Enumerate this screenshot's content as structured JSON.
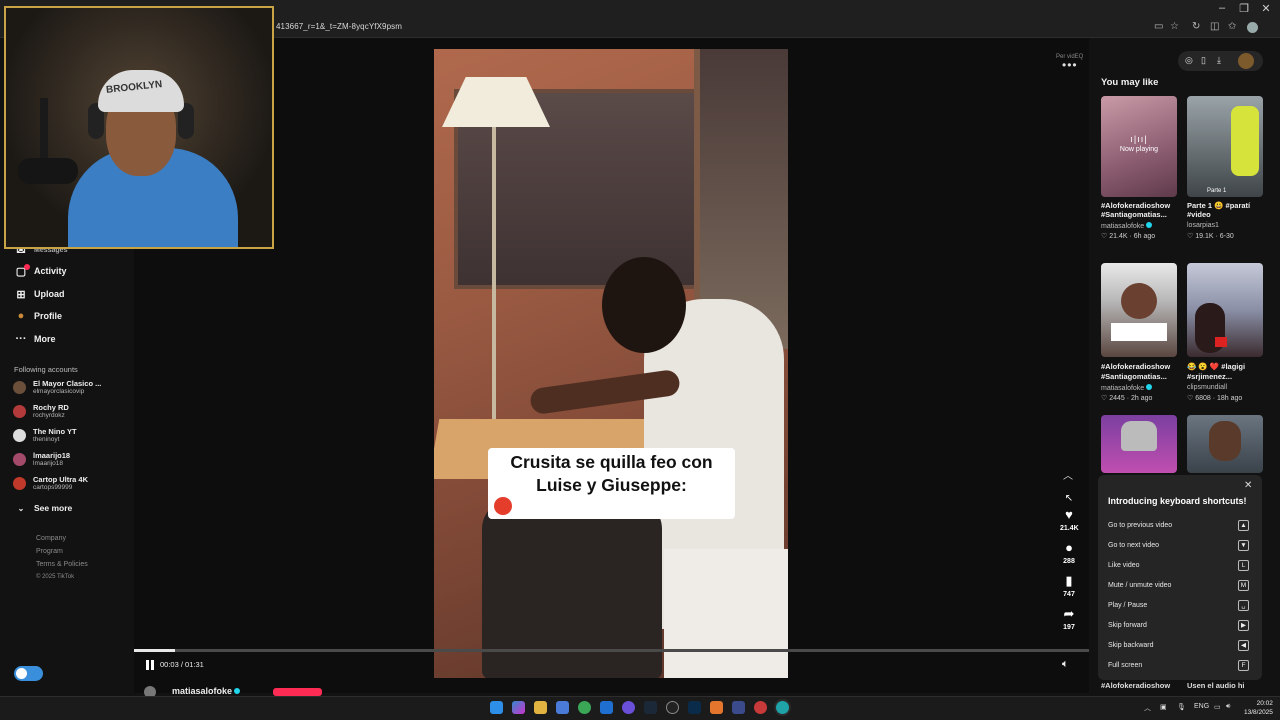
{
  "browser": {
    "url": "413667_r=1&_t=ZM-8yqcYfX9psm",
    "win_minimize": "–",
    "win_restore": "❐",
    "win_close": "✕"
  },
  "sidebar": {
    "partial_top_label": "Messages",
    "nav": [
      {
        "label": "Activity",
        "icon": "activity-icon"
      },
      {
        "label": "Upload",
        "icon": "upload-icon"
      },
      {
        "label": "Profile",
        "icon": "profile-icon"
      },
      {
        "label": "More",
        "icon": "more-icon"
      }
    ],
    "following_title": "Following accounts",
    "accounts": [
      {
        "name": "El Mayor Clasico ...",
        "handle": "elmayorclasicovip",
        "color": "#6b4f3a"
      },
      {
        "name": "Rochy RD",
        "handle": "rochyrdokz",
        "color": "#b33a3a"
      },
      {
        "name": "The Nino YT",
        "handle": "theninoyt",
        "color": "#dcdcdc"
      },
      {
        "name": "lmaarijo18",
        "handle": "lmaarijo18",
        "color": "#a34a6a"
      },
      {
        "name": "Cartop Ultra 4K",
        "handle": "cartops99999",
        "color": "#c0392b"
      }
    ],
    "see_more": "See more",
    "footer": [
      "Company",
      "Program",
      "Terms & Policies",
      "© 2025 TikTok"
    ]
  },
  "webcam": {
    "cap_text": "BROOKLYN"
  },
  "video": {
    "caption_line1": "Crusita se quilla feo con",
    "caption_line2": "Luise y Giuseppe:",
    "per_video": "Per vidEQ",
    "more": "•••",
    "likes": "21.4K",
    "comments": "288",
    "saves": "747",
    "shares": "197",
    "time": "00:03 / 01:31",
    "progress": 0.043,
    "author": "matiasalofoke"
  },
  "right": {
    "heading": "You may like",
    "cards": [
      {
        "title1": "#Alofokeradioshow",
        "title2": "#Santiagomatias...",
        "author": "matiasalofoke",
        "verified": true,
        "stats": "♡ 21.4K · 6h ago",
        "now_playing": "Now playing",
        "bars": "ı|ıı|"
      },
      {
        "title1": "Parte 1 😃 #paratí",
        "title2": "#video",
        "author": "losarpias1",
        "verified": false,
        "stats": "♡ 19.1K · 6-30",
        "thumb_label": "Parte 1"
      },
      {
        "title1": "#Alofokeradioshow",
        "title2": "#Santiagomatias...",
        "author": "matiasalofoke",
        "verified": true,
        "stats": "♡ 2445 · 2h ago"
      },
      {
        "title1": "😂 😮 ❤️ #lagigi",
        "title2": "#srjimenez...",
        "author": "clipsmundiall",
        "verified": false,
        "stats": "♡ 6808 · 18h ago"
      }
    ],
    "bottom_left": "#Alofokeradioshow",
    "bottom_right": "Usen el audio hi"
  },
  "shortcuts": {
    "title": "Introducing keyboard shortcuts!",
    "close": "✕",
    "rows": [
      {
        "label": "Go to previous video",
        "key": "▲"
      },
      {
        "label": "Go to next video",
        "key": "▼"
      },
      {
        "label": "Like video",
        "key": "L"
      },
      {
        "label": "Mute / unmute video",
        "key": "M"
      },
      {
        "label": "Play / Pause",
        "key": "␣"
      },
      {
        "label": "Skip forward",
        "key": "▶"
      },
      {
        "label": "Skip backward",
        "key": "◀"
      },
      {
        "label": "Full screen",
        "key": "F"
      }
    ]
  },
  "taskbar": {
    "lang": "ENG",
    "time": "20:02",
    "date": "13/8/2025"
  }
}
